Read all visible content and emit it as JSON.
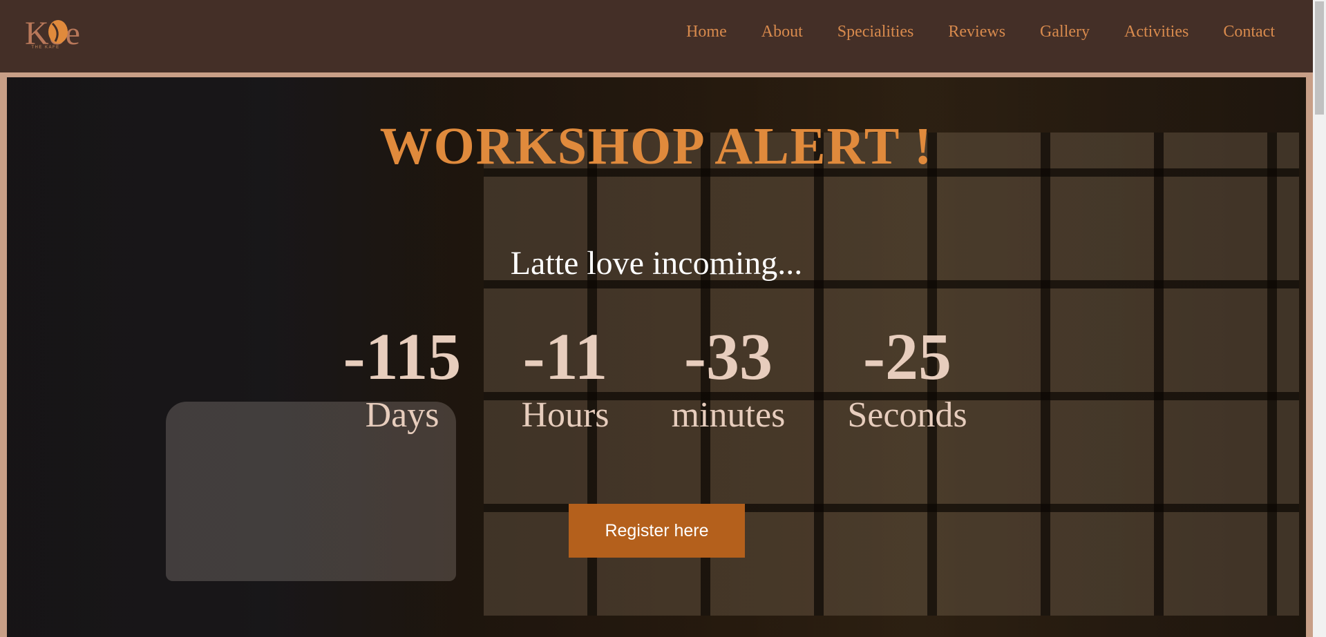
{
  "brand": {
    "logo_text": "Kôe",
    "tagline": "THE KAFE"
  },
  "nav": {
    "items": [
      {
        "label": "Home"
      },
      {
        "label": "About"
      },
      {
        "label": "Specialities"
      },
      {
        "label": "Reviews"
      },
      {
        "label": "Gallery"
      },
      {
        "label": "Activities"
      },
      {
        "label": "Contact"
      }
    ]
  },
  "hero": {
    "title": "WORKSHOP ALERT !",
    "subtitle": "Latte love incoming...",
    "countdown": {
      "days": {
        "value": "-115",
        "label": "Days"
      },
      "hours": {
        "value": "-11",
        "label": "Hours"
      },
      "minutes": {
        "value": "-33",
        "label": "minutes"
      },
      "seconds": {
        "value": "-25",
        "label": "Seconds"
      }
    },
    "cta_label": "Register here"
  },
  "colors": {
    "header_bg": "#442f27",
    "accent": "#e08a3c",
    "nav_text": "#d88a4d",
    "button_bg": "#b4601c",
    "counter_text": "#e7cdbd"
  }
}
